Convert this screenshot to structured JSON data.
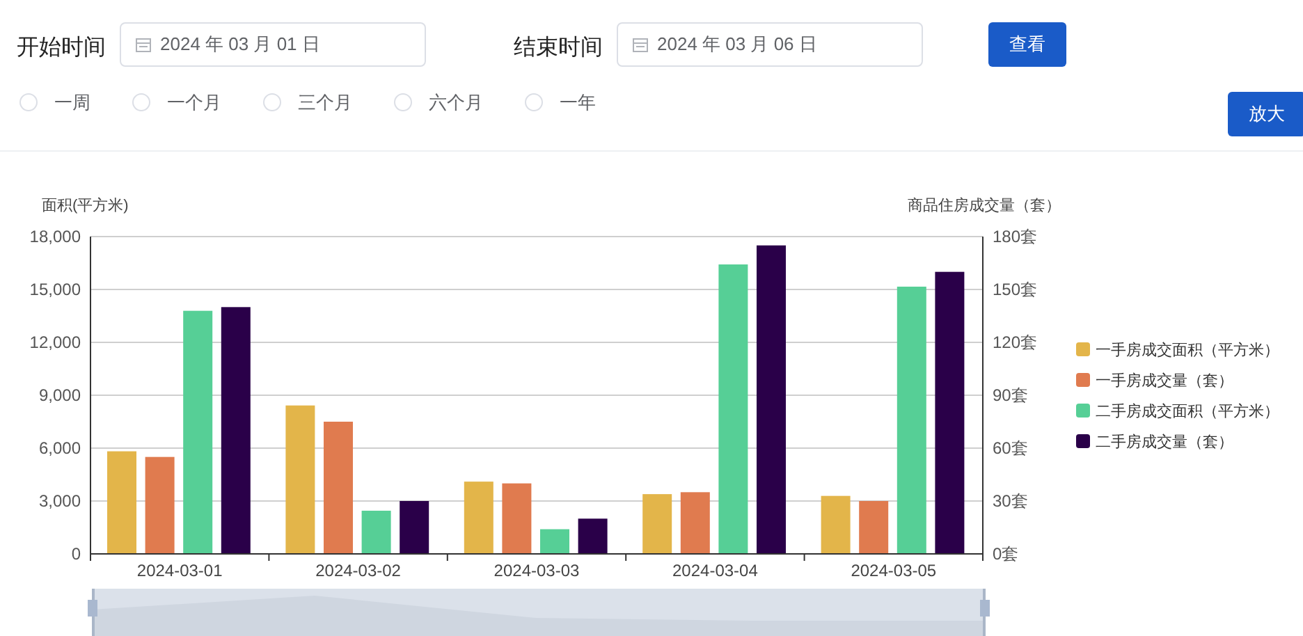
{
  "filters": {
    "start": {
      "label": "开始时间",
      "value": "2024 年 03 月 01 日"
    },
    "end": {
      "label": "结束时间",
      "value": "2024 年 03 月 06 日"
    },
    "query_button": "查看",
    "ranges": [
      {
        "label": "一周",
        "selected": false
      },
      {
        "label": "一个月",
        "selected": false
      },
      {
        "label": "三个月",
        "selected": false
      },
      {
        "label": "六个月",
        "selected": false
      },
      {
        "label": "一年",
        "selected": false
      }
    ]
  },
  "zoom_button": "放大",
  "chart": {
    "chart_data": {
      "type": "bar",
      "ylabel": "面积(平方米)",
      "y2label": "商品住房成交量（套）",
      "grid": true,
      "legend": "right",
      "categories": [
        "2024-03-01",
        "2024-03-02",
        "2024-03-03",
        "2024-03-04",
        "2024-03-05"
      ],
      "ylim": [
        0,
        18000
      ],
      "stacked": false,
      "yticks": [
        {
          "value": 0,
          "label": "0"
        },
        {
          "value": 3000,
          "label": "3,000"
        },
        {
          "value": 6000,
          "label": "6,000"
        },
        {
          "value": 9000,
          "label": "9,000"
        },
        {
          "value": 12000,
          "label": "12,000"
        },
        {
          "value": 15000,
          "label": "15,000"
        },
        {
          "value": 18000,
          "label": "18,000"
        }
      ],
      "y2lim": [
        0,
        180
      ],
      "y2ticks": [
        {
          "value": 0,
          "label": "0套"
        },
        {
          "value": 30,
          "label": "30套"
        },
        {
          "value": 60,
          "label": "60套"
        },
        {
          "value": 90,
          "label": "90套"
        },
        {
          "value": 120,
          "label": "120套"
        },
        {
          "value": 150,
          "label": "150套"
        },
        {
          "value": 180,
          "label": "180套"
        }
      ],
      "series": [
        {
          "name": "一手房成交面积（平方米）",
          "color": "#e3b54a",
          "values": [
            5820,
            8420,
            4100,
            3390,
            3290
          ]
        },
        {
          "name": "一手房成交量（套）",
          "color": "#e07b4f",
          "axis": "y2",
          "values": [
            55,
            75,
            40,
            35,
            30
          ]
        },
        {
          "name": "二手房成交面积（平方米）",
          "color": "#56cf96",
          "values": [
            13790,
            2450,
            1400,
            16420,
            15160
          ]
        },
        {
          "name": "二手房成交量（套）",
          "color": "#2a0049",
          "axis": "y2",
          "values": [
            140,
            30,
            20,
            175,
            160
          ]
        }
      ]
    }
  }
}
